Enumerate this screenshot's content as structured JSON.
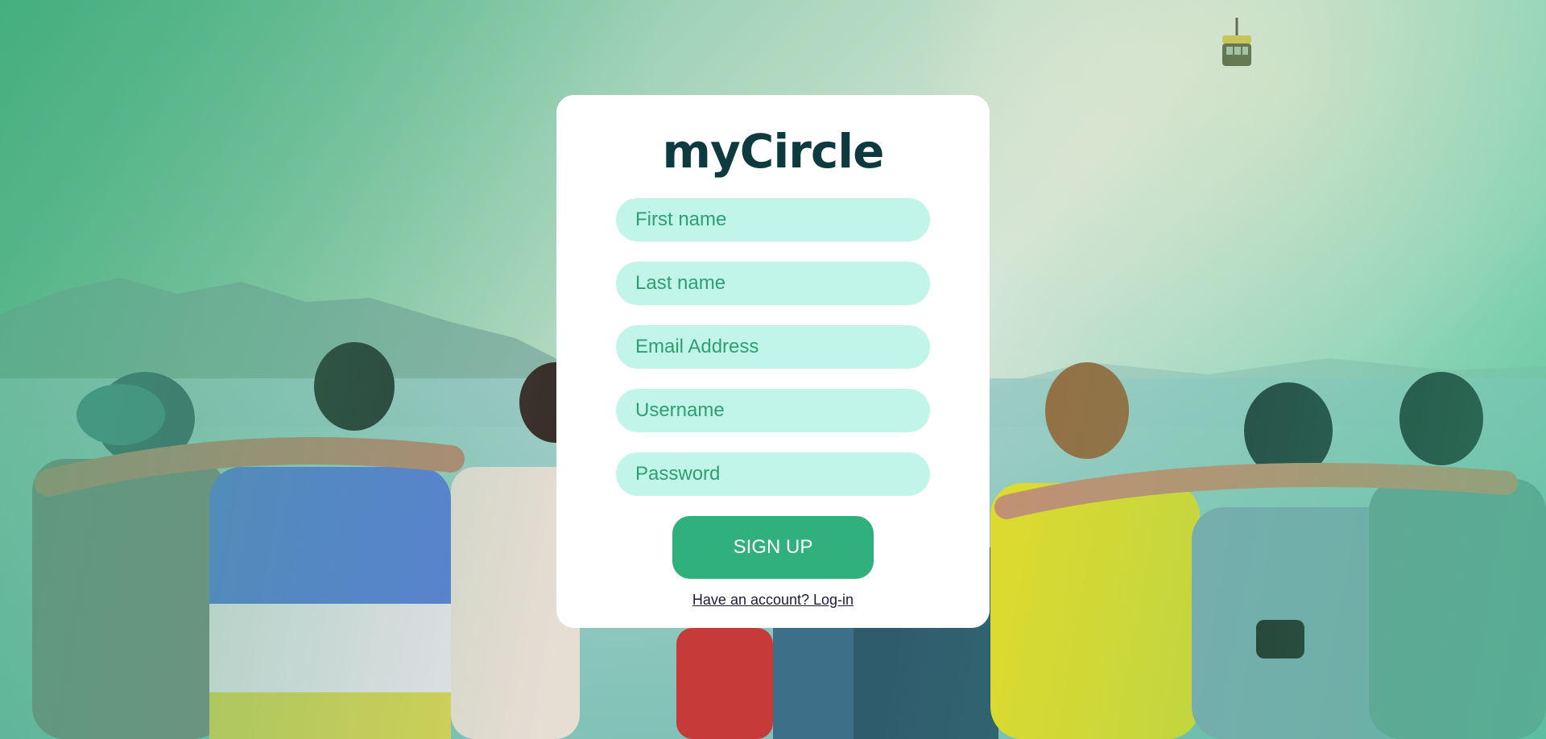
{
  "app": {
    "brand": "myCircle"
  },
  "form": {
    "first_name_placeholder": "First name",
    "last_name_placeholder": "Last name",
    "email_placeholder": "Email Address",
    "username_placeholder": "Username",
    "password_placeholder": "Password",
    "signup_label": "SIGN UP",
    "login_link_label": "Have an account? Log-in"
  },
  "colors": {
    "brand_text": "#0c3a3e",
    "field_bg": "#c2f5ea",
    "field_text": "#2e9f6f",
    "button_bg": "#2fb07c",
    "card_bg": "#ffffff"
  }
}
